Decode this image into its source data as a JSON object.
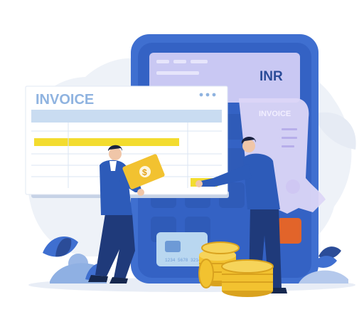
{
  "invoice_card": {
    "title": "INVOICE"
  },
  "calculator": {
    "display_text": "INR"
  },
  "receipt": {
    "title": "INVOICE"
  },
  "card": {
    "number_text": "1234 5678 3214"
  },
  "colors": {
    "background_blob": "#eef2f8",
    "calculator_body": "#3f6fd0",
    "calculator_dark": "#2b4c98",
    "display": "#c9c8f3",
    "invoice_title": "#8fb3e0",
    "yellow_bar": "#f3dc2f",
    "coin": "#f2c230",
    "suit": "#1f3a7a",
    "orange_key": "#e2642a",
    "receipt": "#dcd6f7"
  },
  "icons": [
    "dots-menu-icon",
    "dollar-icon",
    "coin-stack-icon",
    "credit-card-icon",
    "leaf-icon"
  ]
}
